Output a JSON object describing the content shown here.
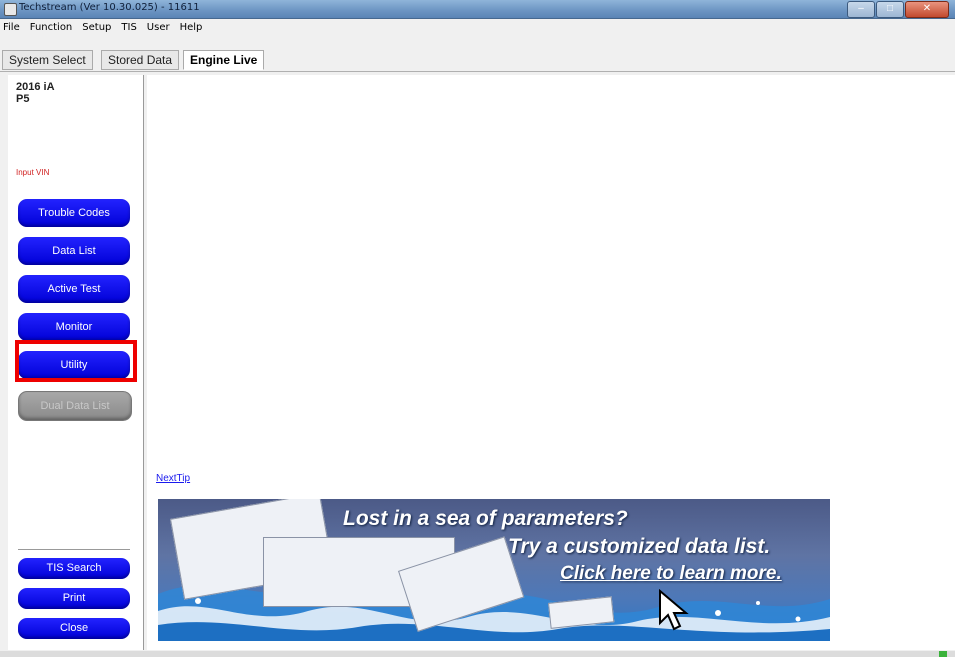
{
  "window": {
    "title": "Techstream (Ver 10.30.025) - 11611"
  },
  "menu": [
    "File",
    "Function",
    "Setup",
    "TIS",
    "User",
    "Help"
  ],
  "tabs": [
    "System Select",
    "Stored Data",
    "Engine Live"
  ],
  "active_tab": "Engine Live",
  "vehicle": {
    "line1": "2016 iA",
    "line2": "P5"
  },
  "sidebar": {
    "input_vin": "Input VIN",
    "buttons": [
      "Trouble Codes",
      "Data List",
      "Active Test",
      "Monitor",
      "Utility",
      "Dual Data List"
    ],
    "highlighted_button": "Utility",
    "disabled_button": "Dual Data List",
    "bottom_buttons": [
      "TIS Search",
      "Print",
      "Close"
    ]
  },
  "main": {
    "next_tip": "NextTip",
    "banner": {
      "line1": "Lost in a sea of parameters?",
      "line2": "Try a customized data list.",
      "line3": "Click here to learn more."
    }
  },
  "colors": {
    "button_blue": "#0000ee",
    "highlight_red": "#ee0000",
    "link_blue": "#1a1aee"
  }
}
